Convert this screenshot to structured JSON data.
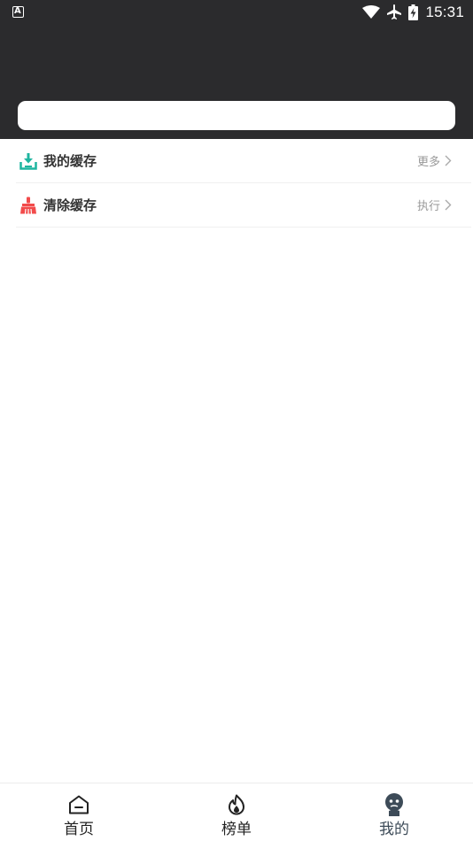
{
  "status_bar": {
    "notification_icon_letter": "A",
    "time": "15:31",
    "icons": [
      "wifi-icon",
      "airplane-icon",
      "battery-charging-icon"
    ]
  },
  "header": {
    "search_placeholder": ""
  },
  "menu": {
    "items": [
      {
        "label": "我的缓存",
        "action": "更多",
        "icon": "download-icon",
        "icon_color": "#1fb5a0"
      },
      {
        "label": "清除缓存",
        "action": "执行",
        "icon": "broom-icon",
        "icon_color": "#f24b4b"
      }
    ]
  },
  "bottom_nav": {
    "items": [
      {
        "label": "首页",
        "icon": "home-icon",
        "active": false
      },
      {
        "label": "榜单",
        "icon": "flame-icon",
        "active": false
      },
      {
        "label": "我的",
        "icon": "profile-icon",
        "active": true
      }
    ]
  },
  "colors": {
    "header_bg": "#2b2b2d",
    "active_nav": "#3d4b58",
    "muted_text": "#999999"
  }
}
